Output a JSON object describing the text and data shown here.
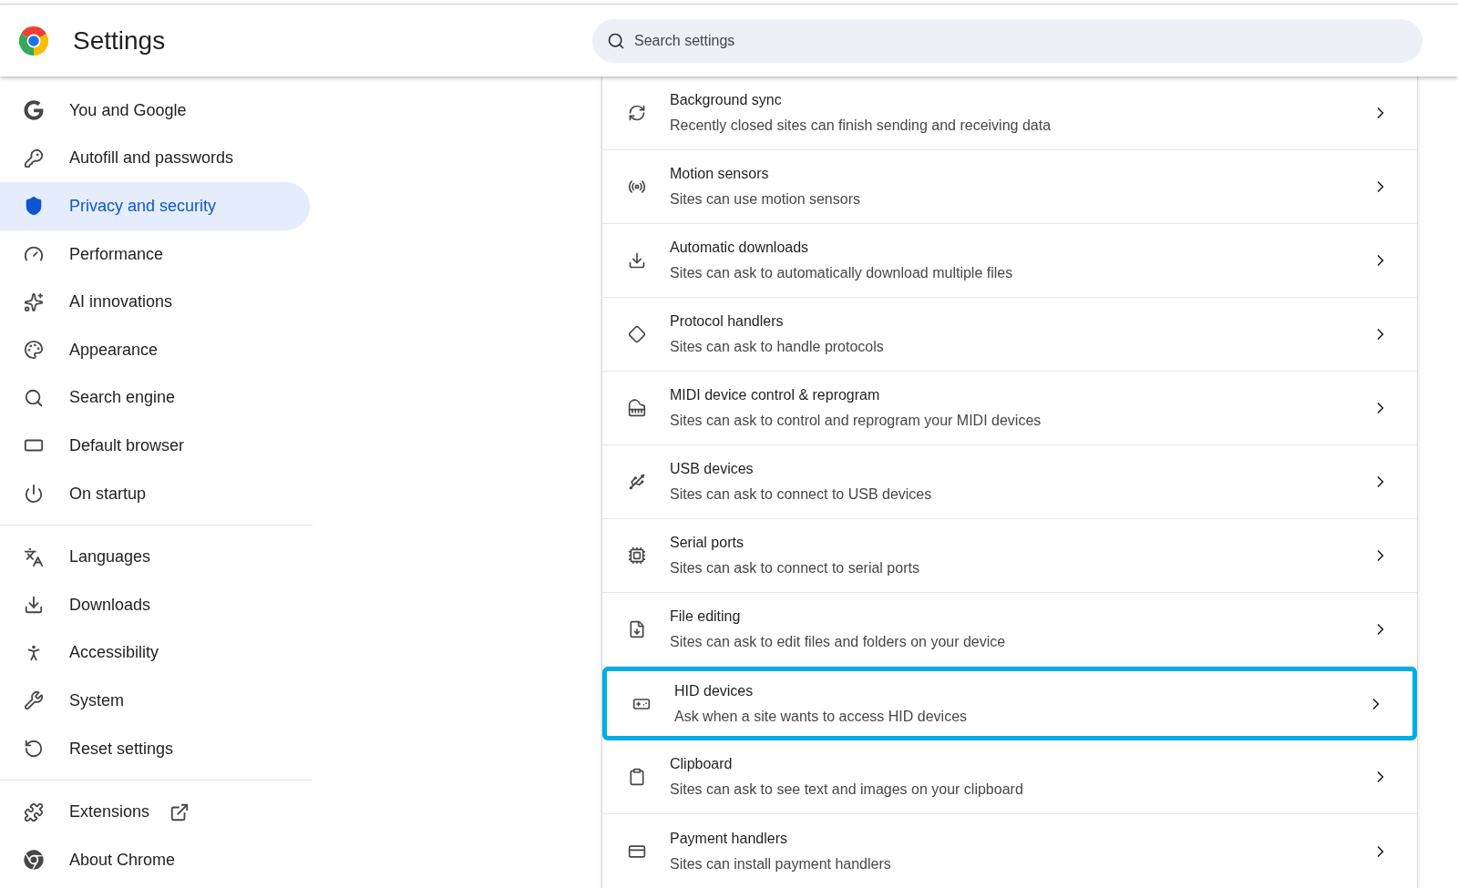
{
  "header": {
    "title": "Settings",
    "search": {
      "placeholder": "Search settings"
    }
  },
  "sidebar": {
    "groups": [
      [
        {
          "label": "You and Google",
          "selected": false
        },
        {
          "label": "Autofill and passwords",
          "selected": false
        },
        {
          "label": "Privacy and security",
          "selected": true
        },
        {
          "label": "Performance",
          "selected": false
        },
        {
          "label": "AI innovations",
          "selected": false
        },
        {
          "label": "Appearance",
          "selected": false
        },
        {
          "label": "Search engine",
          "selected": false
        },
        {
          "label": "Default browser",
          "selected": false
        },
        {
          "label": "On startup",
          "selected": false
        }
      ],
      [
        {
          "label": "Languages",
          "selected": false
        },
        {
          "label": "Downloads",
          "selected": false
        },
        {
          "label": "Accessibility",
          "selected": false
        },
        {
          "label": "System",
          "selected": false
        },
        {
          "label": "Reset settings",
          "selected": false
        }
      ],
      [
        {
          "label": "Extensions",
          "selected": false,
          "external": true
        },
        {
          "label": "About Chrome",
          "selected": false
        }
      ]
    ]
  },
  "permissions": [
    {
      "title": "Background sync",
      "description": "Recently closed sites can finish sending and receiving data",
      "highlighted": false
    },
    {
      "title": "Motion sensors",
      "description": "Sites can use motion sensors",
      "highlighted": false
    },
    {
      "title": "Automatic downloads",
      "description": "Sites can ask to automatically download multiple files",
      "highlighted": false
    },
    {
      "title": "Protocol handlers",
      "description": "Sites can ask to handle protocols",
      "highlighted": false
    },
    {
      "title": "MIDI device control & reprogram",
      "description": "Sites can ask to control and reprogram your MIDI devices",
      "highlighted": false
    },
    {
      "title": "USB devices",
      "description": "Sites can ask to connect to USB devices",
      "highlighted": false
    },
    {
      "title": "Serial ports",
      "description": "Sites can ask to connect to serial ports",
      "highlighted": false
    },
    {
      "title": "File editing",
      "description": "Sites can ask to edit files and folders on your device",
      "highlighted": false
    },
    {
      "title": "HID devices",
      "description": "Ask when a site wants to access HID devices",
      "highlighted": true
    },
    {
      "title": "Clipboard",
      "description": "Sites can ask to see text and images on your clipboard",
      "highlighted": false
    },
    {
      "title": "Payment handlers",
      "description": "Sites can install payment handlers",
      "highlighted": false
    }
  ]
}
